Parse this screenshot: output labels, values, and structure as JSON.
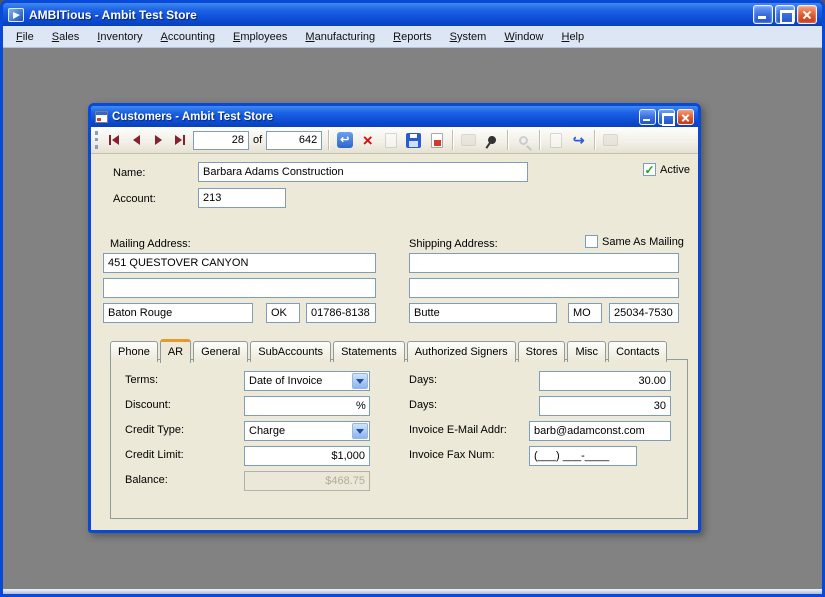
{
  "colors": {
    "titlebar_blue": "#1d63e6",
    "window_border_blue": "#0849d8",
    "form_background": "#ece9d8",
    "workspace_gray": "#828282",
    "selected_tab_accent": "#e89a28",
    "field_border": "#7f9db9",
    "check_green": "#21a121",
    "delete_red": "#cc1111",
    "nav_arrow_maroon": "#8a1f2d"
  },
  "app": {
    "title": "AMBITious - Ambit Test Store",
    "menu": [
      "File",
      "Sales",
      "Inventory",
      "Accounting",
      "Employees",
      "Manufacturing",
      "Reports",
      "System",
      "Window",
      "Help"
    ]
  },
  "customers": {
    "title": "Customers - Ambit Test Store",
    "toolbar": {
      "record_position": "28",
      "of_label": "of",
      "record_total": "642",
      "icons": [
        {
          "name": "refresh-icon",
          "glyph": "↩"
        },
        {
          "name": "delete-icon",
          "glyph": "×"
        },
        {
          "name": "new-record-icon",
          "glyph": ""
        },
        {
          "name": "save-icon",
          "glyph": ""
        },
        {
          "name": "void-record-icon",
          "glyph": ""
        },
        {
          "name": "print-icon",
          "glyph": ""
        },
        {
          "name": "pushpin-icon",
          "glyph": ""
        },
        {
          "name": "search-icon",
          "glyph": ""
        },
        {
          "name": "report-icon",
          "glyph": ""
        },
        {
          "name": "goto-icon",
          "glyph": "↪"
        },
        {
          "name": "attachment-icon",
          "glyph": ""
        }
      ]
    },
    "header": {
      "name_label": "Name:",
      "name_value": "Barbara Adams Construction",
      "active_label": "Active",
      "account_label": "Account:",
      "account_value": "213"
    },
    "mailing": {
      "label": "Mailing Address:",
      "line1": "451 QUESTOVER CANYON",
      "line2": "",
      "city": "Baton Rouge",
      "state": "OK",
      "zip": "01786-8138"
    },
    "shipping": {
      "label": "Shipping Address:",
      "same_as_mailing_label": "Same As Mailing",
      "line1": "",
      "line2": "",
      "city": "Butte",
      "state": "MO",
      "zip": "25034-7530"
    },
    "tabs": [
      "Phone",
      "AR",
      "General",
      "SubAccounts",
      "Statements",
      "Authorized Signers",
      "Stores",
      "Misc",
      "Contacts"
    ],
    "active_tab": "AR",
    "ar": {
      "terms_label": "Terms:",
      "terms_value": "Date of Invoice",
      "discount_label": "Discount:",
      "discount_value": "",
      "discount_suffix": "%",
      "credit_type_label": "Credit Type:",
      "credit_type_value": "Charge",
      "credit_limit_label": "Credit Limit:",
      "credit_limit_value": "$1,000",
      "balance_label": "Balance:",
      "balance_value": "$468.75",
      "days_terms_label": "Days:",
      "days_terms_value": "30.00",
      "days_discount_label": "Days:",
      "days_discount_value": "30",
      "invoice_email_label": "Invoice E-Mail Addr:",
      "invoice_email_value": "barb@adamconst.com",
      "invoice_fax_label": "Invoice Fax Num:",
      "invoice_fax_value": "(___) ___-____"
    }
  }
}
